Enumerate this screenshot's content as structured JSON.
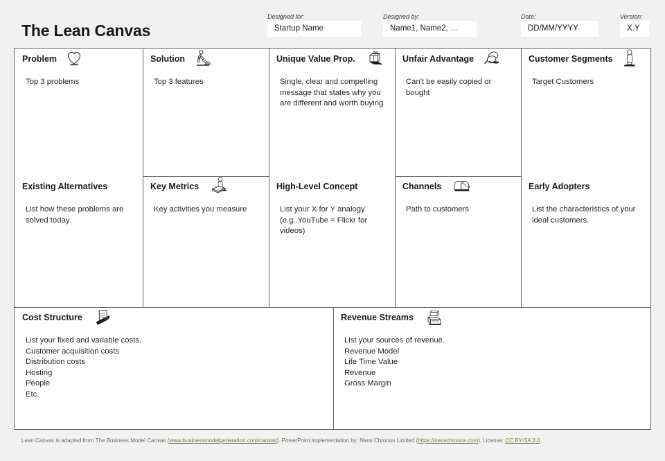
{
  "header": {
    "title": "The Lean Canvas",
    "fields": [
      {
        "label": "Designed for:",
        "value": "Startup Name",
        "name": "designed-for"
      },
      {
        "label": "Designed by:",
        "value": "Name1, Name2, …",
        "name": "designed-by"
      },
      {
        "label": "Date:",
        "value": "DD/MM/YYYY",
        "name": "date"
      },
      {
        "label": "Version:",
        "value": "X.Y",
        "name": "version"
      }
    ]
  },
  "cells": {
    "problem": {
      "title": "Problem",
      "icon": "heart-icon",
      "lines": [
        "Top 3 problems"
      ]
    },
    "solution": {
      "title": "Solution",
      "icon": "person-sweeping-icon",
      "lines": [
        "Top 3 features"
      ]
    },
    "unique_value_prop": {
      "title": "Unique Value Prop.",
      "icon": "gift-box-icon",
      "lines": [
        "Single, clear and compelling",
        "message that states why you",
        "are different and worth buying"
      ]
    },
    "unfair_advantage": {
      "title": "Unfair Advantage",
      "icon": "magnifier-lens-icon",
      "lines": [
        "Can't be easily copied or",
        "bought"
      ]
    },
    "customer_segments": {
      "title": "Customer Segments",
      "icon": "standing-person-icon",
      "lines": [
        "Target Customers"
      ]
    },
    "existing_alternatives": {
      "title": "Existing Alternatives",
      "icon": "",
      "lines": [
        "List how these problems are",
        "solved today."
      ]
    },
    "key_metrics": {
      "title": "Key Metrics",
      "icon": "person-on-treadmill-icon",
      "lines": [
        "Key activities you measure"
      ]
    },
    "high_level_concept": {
      "title": "High-Level Concept",
      "icon": "",
      "lines": [
        "List your X for Y analogy",
        "(e.g. YouTube = Flickr for",
        "videos)"
      ]
    },
    "channels": {
      "title": "Channels",
      "icon": "mailbox-icon",
      "lines": [
        "Path to customers"
      ]
    },
    "early_adopters": {
      "title": "Early Adopters",
      "icon": "",
      "lines": [
        "List the characteristics of your",
        "ideal customers."
      ]
    },
    "cost_structure": {
      "title": "Cost Structure",
      "icon": "document-pen-icon",
      "lines": [
        "List your fixed and variable costs.",
        "Customer acquisition costs",
        "Distribution costs",
        "Hosting",
        "People",
        "Etc."
      ]
    },
    "revenue_streams": {
      "title": "Revenue Streams",
      "icon": "cash-register-icon",
      "lines": [
        "List your sources of revenue.",
        "Revenue Model",
        "Life Time Value",
        "Revenue",
        "Gross Margin"
      ]
    }
  },
  "footer": {
    "part1": "Lean Canvas is adapted from The Business Model Canvas (",
    "link1": "www.businessmodelgeneration.com/canvas",
    "part2": "). PowerPoint implementation by: Neos Chronos Limited (",
    "link2": "https://neoschronos.com",
    "part3": "). License: ",
    "link3": "CC BY-SA 3.0"
  },
  "colors": {
    "page_background": "#f1f1f1",
    "canvas_background": "#ffffff",
    "border": "#636363",
    "text": "#231f20",
    "link": "#7d7a3c"
  }
}
